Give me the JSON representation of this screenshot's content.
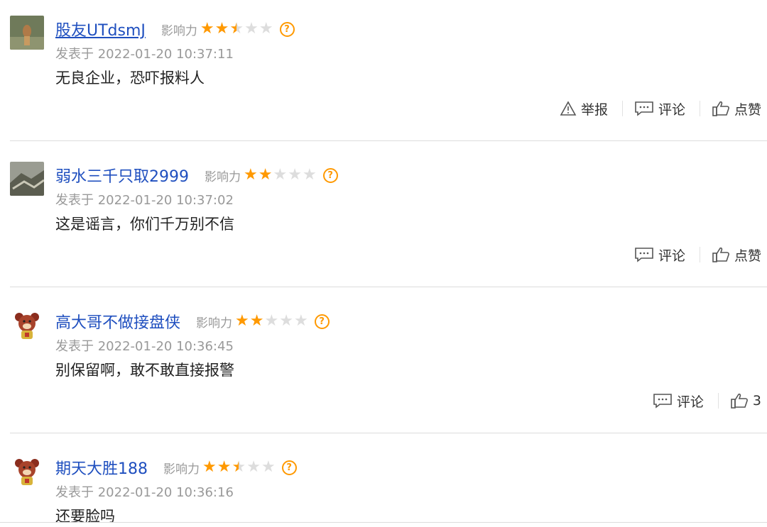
{
  "influence_label": "影响力",
  "published_prefix": "发表于",
  "actions": {
    "report": "举报",
    "comment": "评论",
    "like": "点赞"
  },
  "comments": [
    {
      "username": "股友UTdsmJ",
      "stars": 2.5,
      "time": "2022-01-20 10:37:11",
      "text": "无良企业，恐吓报料人"
    },
    {
      "username": "弱水三千只取2999",
      "stars": 2,
      "time": "2022-01-20 10:37:02",
      "text": "这是谣言，你们千万别不信"
    },
    {
      "username": "高大哥不做接盘侠",
      "stars": 2,
      "time": "2022-01-20 10:36:45",
      "text": "别保留啊，敢不敢直接报警",
      "like_count": "3"
    },
    {
      "username": "期天大胜188",
      "stars": 2.5,
      "time": "2022-01-20 10:36:16",
      "text": "还要脸吗"
    }
  ],
  "colors": {
    "username": "#1f4fbf",
    "star": "#ff9900",
    "meta": "#999999"
  }
}
